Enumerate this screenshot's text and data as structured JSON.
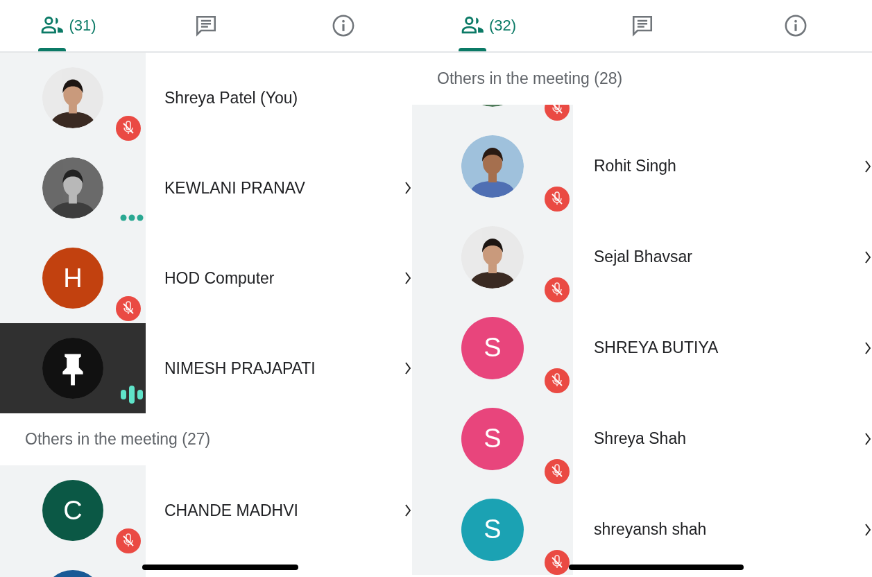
{
  "panels": [
    {
      "tabs": [
        {
          "kind": "people",
          "label": "(31)",
          "selected": true
        },
        {
          "kind": "chat",
          "selected": false
        },
        {
          "kind": "info",
          "selected": false
        }
      ],
      "items": [
        {
          "kind": "participant",
          "name": "Shreya Patel (You)",
          "badge": {
            "kind": "muted"
          },
          "chevron": false,
          "pinned": false
        },
        {
          "kind": "participant",
          "name": "KEWLANI PRANAV",
          "badge": {
            "kind": "more"
          },
          "chevron": true,
          "pinned": false
        },
        {
          "kind": "participant",
          "name": "HOD Computer",
          "avatar": {
            "kind": "letter",
            "letter": "H",
            "color": "#c2410f"
          },
          "badge": {
            "kind": "muted"
          },
          "chevron": true,
          "pinned": false
        },
        {
          "kind": "participant",
          "name": "NIMESH PRAJAPATI",
          "avatar": {
            "kind": "pin"
          },
          "badge": {
            "kind": "speaking"
          },
          "chevron": true,
          "pinned": true
        },
        {
          "kind": "header",
          "label": "Others in the meeting (27)"
        },
        {
          "kind": "participant",
          "name": "CHANDE MADHVI",
          "avatar": {
            "kind": "letter",
            "letter": "C",
            "color": "#0b5845"
          },
          "badge": {
            "kind": "muted"
          },
          "chevron": true,
          "pinned": false
        },
        {
          "kind": "participant",
          "avatar": {
            "kind": "letter",
            "color": "#195a96"
          },
          "chevron": false,
          "pinned": false
        }
      ]
    },
    {
      "tabs": [
        {
          "kind": "people",
          "label": "(32)",
          "selected": true
        },
        {
          "kind": "chat",
          "selected": false
        },
        {
          "kind": "info",
          "selected": false
        }
      ],
      "header": "Others in the meeting (28)",
      "items": [
        {
          "kind": "participant",
          "badge": {
            "kind": "muted"
          },
          "chevron": false,
          "pinned": false
        },
        {
          "kind": "participant",
          "name": "Rohit Singh",
          "badge": {
            "kind": "muted"
          },
          "chevron": true,
          "pinned": false
        },
        {
          "kind": "participant",
          "name": "Sejal Bhavsar",
          "badge": {
            "kind": "muted"
          },
          "chevron": true,
          "pinned": false
        },
        {
          "kind": "participant",
          "name": "SHREYA BUTIYA",
          "avatar": {
            "kind": "letter",
            "letter": "S",
            "color": "#e8457c"
          },
          "badge": {
            "kind": "muted"
          },
          "chevron": true,
          "pinned": false
        },
        {
          "kind": "participant",
          "name": "Shreya Shah",
          "avatar": {
            "kind": "letter",
            "letter": "S",
            "color": "#e8457c"
          },
          "badge": {
            "kind": "muted"
          },
          "chevron": true,
          "pinned": false
        },
        {
          "kind": "participant",
          "name": "shreyansh shah",
          "avatar": {
            "kind": "letter",
            "letter": "S",
            "color": "#1ba2b3"
          },
          "badge": {
            "kind": "muted"
          },
          "chevron": true,
          "pinned": false
        }
      ]
    }
  ]
}
